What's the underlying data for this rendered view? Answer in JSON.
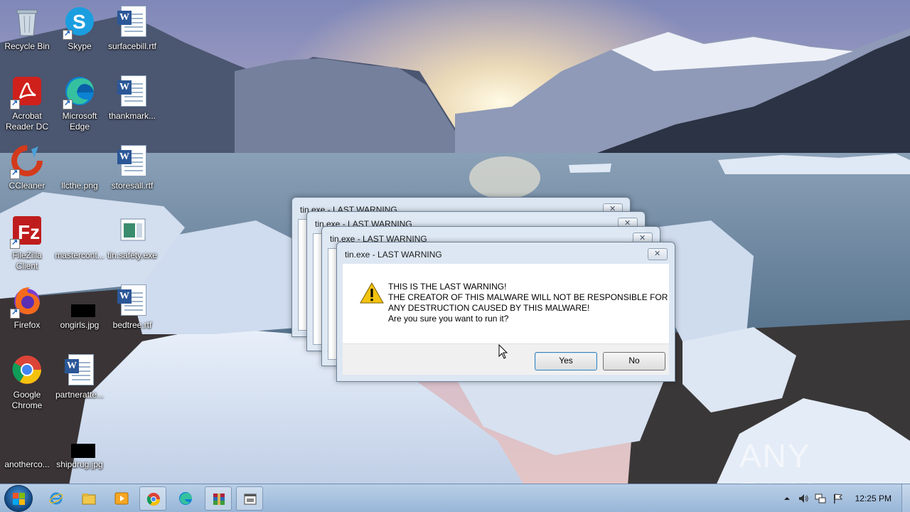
{
  "desktop": {
    "icons": [
      {
        "label": "Recycle Bin",
        "icon": "recycle-bin-icon"
      },
      {
        "label": "Skype",
        "icon": "skype-icon"
      },
      {
        "label": "surfacebill.rtf",
        "icon": "word-document-icon"
      },
      {
        "label": "Acrobat Reader DC",
        "label_lines": [
          "Acrobat",
          "Reader DC"
        ],
        "icon": "acrobat-icon"
      },
      {
        "label": "Microsoft Edge",
        "label_lines": [
          "Microsoft",
          "Edge"
        ],
        "icon": "edge-icon"
      },
      {
        "label": "thankmark...",
        "icon": "word-document-icon"
      },
      {
        "label": "CCleaner",
        "icon": "ccleaner-icon"
      },
      {
        "label": "llcthe.png",
        "icon": "image-file-icon"
      },
      {
        "label": "storesall.rtf",
        "icon": "word-document-icon"
      },
      {
        "label": "FileZilla Client",
        "label_lines": [
          "FileZilla",
          "Client"
        ],
        "icon": "filezilla-icon"
      },
      {
        "label": "mastercont...",
        "icon": "file-icon"
      },
      {
        "label": "tin.safety.exe",
        "icon": "exe-icon"
      },
      {
        "label": "Firefox",
        "icon": "firefox-icon"
      },
      {
        "label": "ongirls.jpg",
        "icon": "image-file-icon"
      },
      {
        "label": "bedtree.rtf",
        "icon": "word-document-icon"
      },
      {
        "label": "Google Chrome",
        "label_lines": [
          "Google",
          "Chrome"
        ],
        "icon": "chrome-icon"
      },
      {
        "label": "partneratte...",
        "icon": "word-document-icon"
      },
      {
        "label": "anotherco...",
        "icon": "file-icon"
      },
      {
        "label": "shipdrug.jpg",
        "icon": "image-file-icon"
      }
    ]
  },
  "background_windows": [
    {
      "title": "tin.exe - LAST WARNING"
    },
    {
      "title": "tin.exe - LAST WARNING"
    },
    {
      "title": "tin.exe - LAST WARNING"
    }
  ],
  "dialog": {
    "title": "tin.exe - LAST WARNING",
    "message_lines": [
      "THIS IS THE LAST WARNING!",
      "THE CREATOR OF THIS MALWARE WILL NOT BE RESPONSIBLE FOR",
      "ANY DESTRUCTION CAUSED BY THIS MALWARE!",
      "Are you sure you want to run it?"
    ],
    "yes_label": "Yes",
    "no_label": "No"
  },
  "taskbar": {
    "items": [
      "internet-explorer-icon",
      "file-explorer-icon",
      "media-player-icon",
      "chrome-icon",
      "edge-icon",
      "winrar-icon",
      "dialog-app-icon"
    ],
    "clock": "12:25 PM"
  },
  "watermark": {
    "text": "ANY RUN"
  },
  "colors": {
    "dialog_frame": "#dde7f3",
    "taskbar": "#a9c3e0",
    "warning": "#f2c40f"
  }
}
